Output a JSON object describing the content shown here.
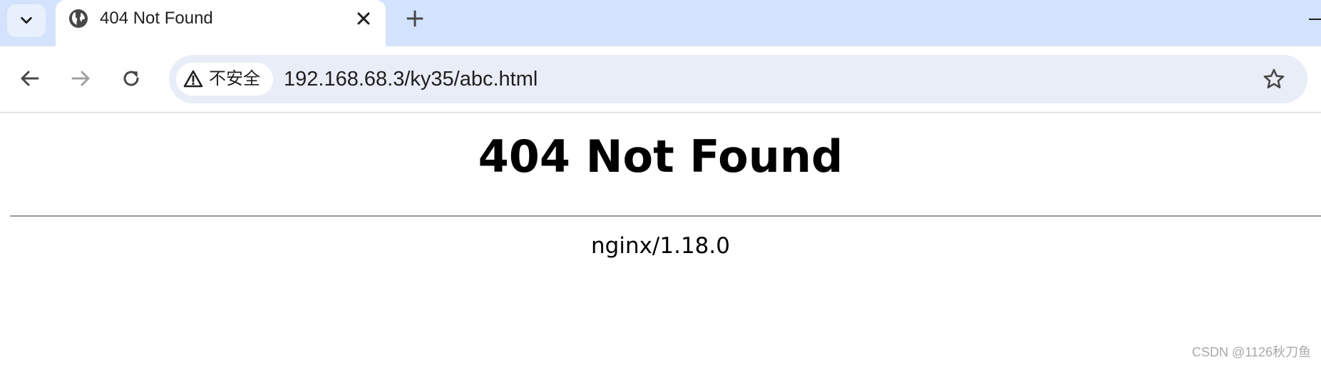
{
  "browser": {
    "tab": {
      "title": "404 Not Found",
      "favicon": "globe-icon",
      "close_icon": "close-icon"
    },
    "tab_search_icon": "chevron-down-icon",
    "new_tab_icon": "plus-icon",
    "toolbar": {
      "back_icon": "arrow-left-icon",
      "forward_icon": "arrow-right-icon",
      "reload_icon": "reload-icon",
      "bookmark_icon": "star-icon"
    },
    "omnibox": {
      "security_icon": "warning-icon",
      "security_label": "不安全",
      "url": "192.168.68.3/ky35/abc.html"
    },
    "colors": {
      "tabbar_bg": "#d3e3fd",
      "omnibox_bg": "#e9edf7",
      "icon": "#474747",
      "icon_disabled": "#a0a0a0"
    }
  },
  "page": {
    "heading": "404 Not Found",
    "server": "nginx/1.18.0"
  },
  "watermark": "CSDN @1126秋刀鱼"
}
